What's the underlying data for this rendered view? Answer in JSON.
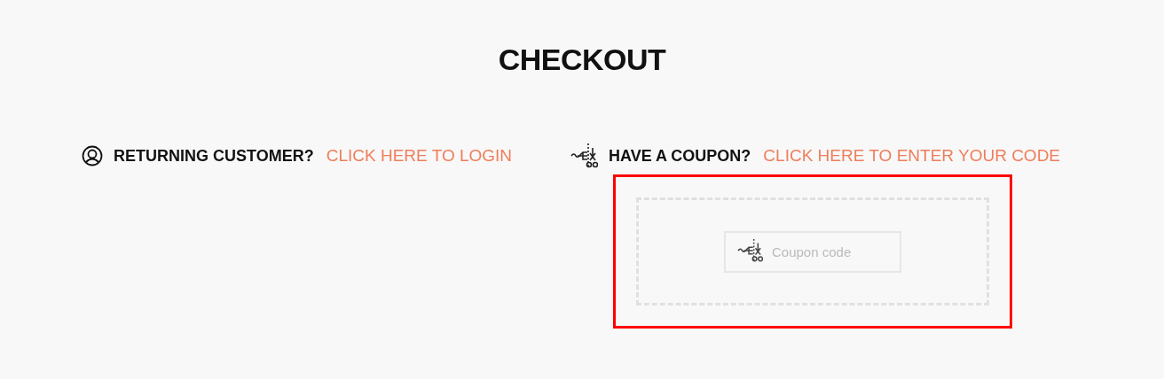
{
  "page_title": "CHECKOUT",
  "returning_customer": {
    "label": "RETURNING CUSTOMER?",
    "link": "CLICK HERE TO LOGIN"
  },
  "coupon": {
    "label": "HAVE A COUPON?",
    "link": "CLICK HERE TO ENTER YOUR CODE",
    "highlighted": true,
    "field": {
      "placeholder": "Coupon code"
    }
  }
}
